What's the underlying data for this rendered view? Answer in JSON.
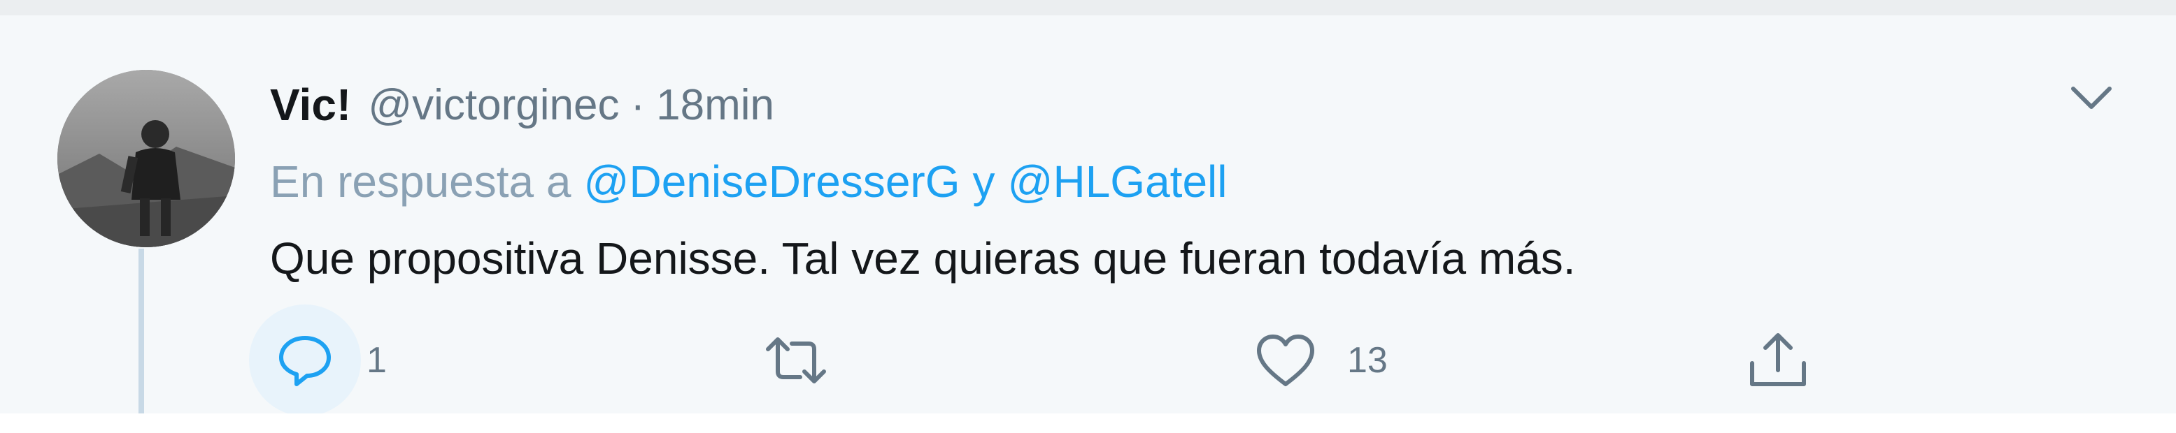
{
  "tweet": {
    "display_name": "Vic!",
    "handle": "@victorginec",
    "separator": "·",
    "time": "18min",
    "reply_prefix": "En respuesta a",
    "reply_mentions": [
      "@DeniseDresserG",
      "@HLGatell"
    ],
    "reply_conjunction": "y",
    "text": "Que propositiva Denisse. Tal vez quieras que fueran todavía más.",
    "avatar_icon": "user-avatar",
    "caret_icon": "chevron-down-icon"
  },
  "actions": {
    "reply": {
      "icon": "reply-icon",
      "count": "1"
    },
    "retweet": {
      "icon": "retweet-icon",
      "count": ""
    },
    "like": {
      "icon": "heart-icon",
      "count": "13"
    },
    "share": {
      "icon": "share-icon",
      "count": ""
    }
  },
  "colors": {
    "background": "#f5f8fa",
    "accent": "#1da1f2",
    "muted_text": "#657786",
    "primary_text": "#14171a"
  }
}
